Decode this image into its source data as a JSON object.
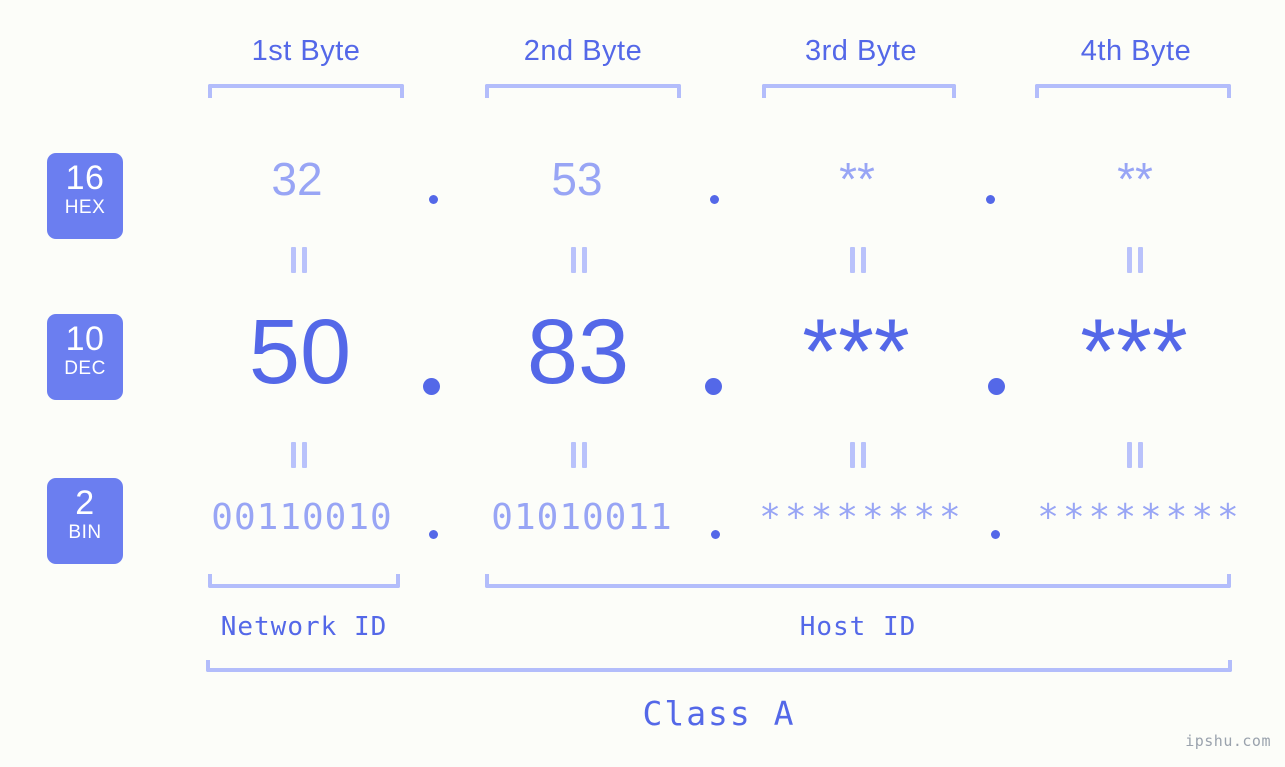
{
  "meta": {
    "watermark": "ipshu.com",
    "accent": "#5468e8",
    "accent_light": "#98a5f5",
    "bracket": "#b3bdfb",
    "badge_bg": "#6b7ef0",
    "background": "#fcfdf9"
  },
  "byte_headers": [
    {
      "label": "1st Byte"
    },
    {
      "label": "2nd Byte"
    },
    {
      "label": "3rd Byte"
    },
    {
      "label": "4th Byte"
    }
  ],
  "radix_badges": [
    {
      "num": "16",
      "word": "HEX"
    },
    {
      "num": "10",
      "word": "DEC"
    },
    {
      "num": "2",
      "word": "BIN"
    }
  ],
  "rows": {
    "hex": {
      "values": [
        "32",
        "53",
        "**",
        "**"
      ],
      "separators": [
        ".",
        ".",
        "."
      ]
    },
    "dec": {
      "values": [
        "50",
        "83",
        "***",
        "***"
      ],
      "separators": [
        ".",
        ".",
        "."
      ]
    },
    "bin": {
      "values": [
        "00110010",
        "01010011",
        "********",
        "********"
      ],
      "separators": [
        ".",
        ".",
        "."
      ]
    }
  },
  "equals_symbol": "=",
  "id_labels": [
    {
      "label": "Network ID"
    },
    {
      "label": "Host ID"
    }
  ],
  "class_label": "Class A"
}
